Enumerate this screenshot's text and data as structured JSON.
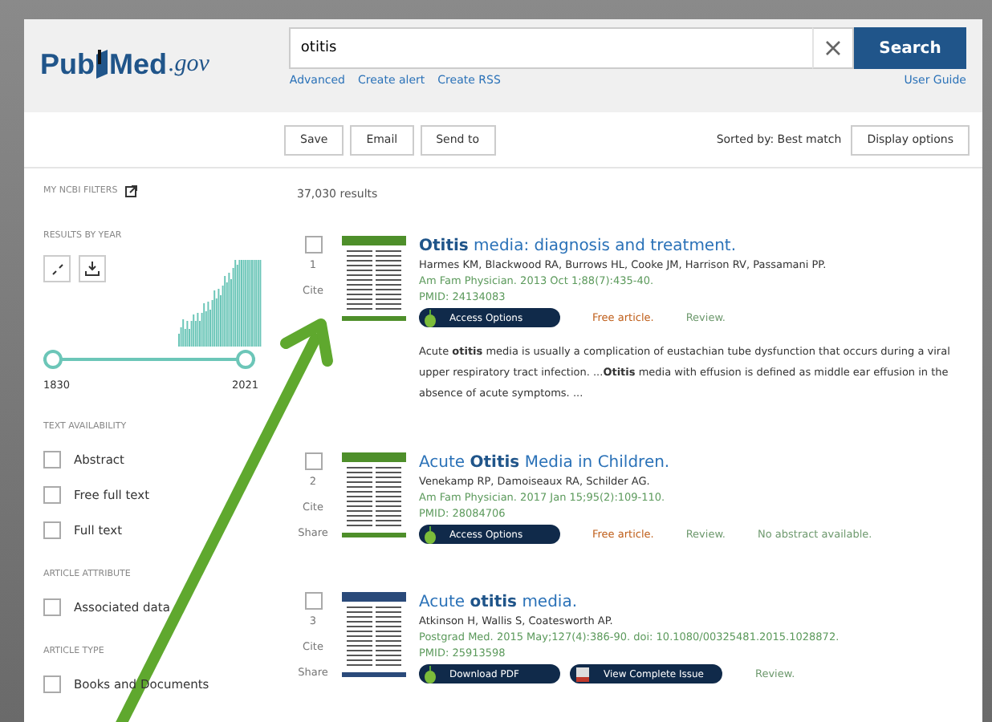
{
  "logo": {
    "name_start": "Pub",
    "name_end": "Med",
    "domain": ".gov"
  },
  "search": {
    "value": "otitis",
    "button": "Search"
  },
  "search_links": [
    "Advanced",
    "Create alert",
    "Create RSS"
  ],
  "user_guide": "User Guide",
  "toolbar": {
    "buttons": [
      "Save",
      "Email",
      "Send to"
    ],
    "sort_label": "Sorted by: Best match",
    "display_button": "Display options"
  },
  "sidebar": {
    "my_filters": "MY NCBI FILTERS",
    "results_by_year": {
      "heading": "RESULTS BY YEAR",
      "start": "1830",
      "end": "2021",
      "level": 1
    },
    "sections": [
      {
        "heading": "TEXT AVAILABILITY",
        "filters": [
          {
            "label": "Abstract",
            "checked": false
          },
          {
            "label": "Free full text",
            "checked": false
          },
          {
            "label": "Full text",
            "checked": false
          }
        ]
      },
      {
        "heading": "ARTICLE ATTRIBUTE",
        "filters": [
          {
            "label": "Associated data",
            "checked": false
          }
        ]
      },
      {
        "heading": "ARTICLE TYPE",
        "filters": [
          {
            "label": "Books and Documents",
            "checked": false
          }
        ]
      }
    ]
  },
  "results_count": "37,030 results",
  "results": [
    {
      "number": "1",
      "checked": false,
      "cite": "Cite",
      "color": "#4e8f2a",
      "title": "**Otitis** media: diagnosis and treatment.",
      "authors": "Harmes KM, Blackwood RA, Burrows HL, Cooke JM, Harrison RV, Passamani PP.",
      "citation": "Am Fam Physician. 2013 Oct 1;88(7):435-40.",
      "pmid": "PMID: 24134083",
      "buttons": [
        {
          "label": "Access Options",
          "kind": "access"
        }
      ],
      "tags": [
        {
          "text": "Free article.",
          "kind": "free"
        },
        {
          "text": "Review.",
          "kind": "note"
        }
      ],
      "snippet": "Acute **otitis** media is usually a complication of eustachian tube dysfunction that occurs during a viral upper respiratory tract infection. ...**Otitis** media with effusion is defined as middle ear effusion in the absence of acute symptoms. ..."
    },
    {
      "number": "2",
      "checked": false,
      "cite": "Cite",
      "share": "Share",
      "color": "#4e8f2a",
      "title": "Acute **Otitis** Media in Children.",
      "authors": "Venekamp RP, Damoiseaux RA, Schilder AG.",
      "citation": "Am Fam Physician. 2017 Jan 15;95(2):109-110.",
      "pmid": "PMID: 28084706",
      "buttons": [
        {
          "label": "Access Options",
          "kind": "access"
        }
      ],
      "tags": [
        {
          "text": "Free article.",
          "kind": "free"
        },
        {
          "text": "Review.",
          "kind": "note"
        },
        {
          "text": "No abstract available.",
          "kind": "note"
        }
      ]
    },
    {
      "number": "3",
      "checked": false,
      "cite": "Cite",
      "share": "Share",
      "color": "#2a4a7a",
      "title": "Acute **otitis** media.",
      "authors": "Atkinson H, Wallis S, Coatesworth AP.",
      "citation": "Postgrad Med. 2015 May;127(4):386-90. doi: 10.1080/00325481.2015.1028872.",
      "pmid": "PMID: 25913598",
      "buttons": [
        {
          "label": "Download PDF",
          "kind": "pdf"
        },
        {
          "label": "View Complete Issue",
          "kind": "issue"
        }
      ],
      "tags": [
        {
          "text": "Review.",
          "kind": "note"
        }
      ]
    }
  ]
}
